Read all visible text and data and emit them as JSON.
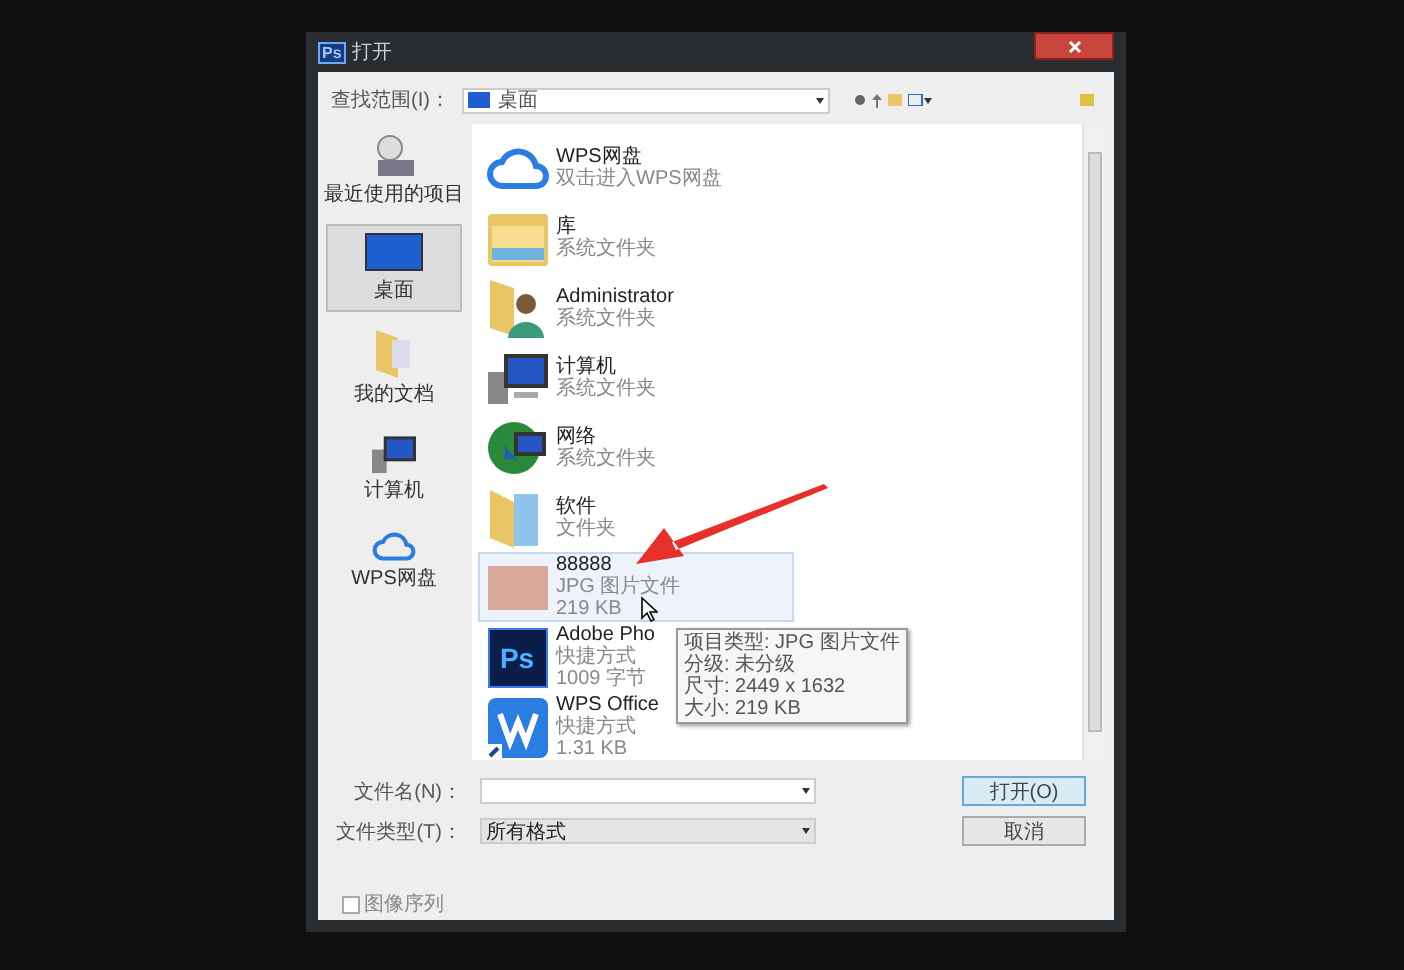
{
  "window": {
    "title": "打开",
    "app_badge": "Ps"
  },
  "look_in": {
    "label": "查找范围(I)：",
    "value": "桌面"
  },
  "sidebar": {
    "items": [
      {
        "label": "最近使用的项目",
        "kind": "recent",
        "selected": false
      },
      {
        "label": "桌面",
        "kind": "desktop",
        "selected": true
      },
      {
        "label": "我的文档",
        "kind": "documents",
        "selected": false
      },
      {
        "label": "计算机",
        "kind": "computer",
        "selected": false
      },
      {
        "label": "WPS网盘",
        "kind": "cloud",
        "selected": false
      }
    ]
  },
  "files": [
    {
      "name": "WPS网盘",
      "detail": [
        "双击进入WPS网盘"
      ],
      "kind": "cloud",
      "selected": false
    },
    {
      "name": "库",
      "detail": [
        "系统文件夹"
      ],
      "kind": "library",
      "selected": false
    },
    {
      "name": "Administrator",
      "detail": [
        "系统文件夹"
      ],
      "kind": "user",
      "selected": false
    },
    {
      "name": "计算机",
      "detail": [
        "系统文件夹"
      ],
      "kind": "computer",
      "selected": false
    },
    {
      "name": "网络",
      "detail": [
        "系统文件夹"
      ],
      "kind": "network",
      "selected": false
    },
    {
      "name": "软件",
      "detail": [
        "文件夹"
      ],
      "kind": "folder",
      "selected": false
    },
    {
      "name": "88888",
      "detail": [
        "JPG 图片文件",
        "219 KB"
      ],
      "kind": "image",
      "selected": true
    },
    {
      "name": "Adobe Pho",
      "detail": [
        "快捷方式",
        "1009 字节"
      ],
      "kind": "ps",
      "badge": "Ps",
      "selected": false
    },
    {
      "name": "WPS Office",
      "detail": [
        "快捷方式",
        "1.31 KB"
      ],
      "kind": "wps",
      "selected": false
    }
  ],
  "tooltip": [
    "项目类型: JPG 图片文件",
    "分级: 未分级",
    "尺寸: 2449 x 1632",
    "大小: 219 KB"
  ],
  "file_name": {
    "label": "文件名(N)："
  },
  "file_type": {
    "label": "文件类型(T)：",
    "value": "所有格式"
  },
  "buttons": [
    {
      "label": "打开(O)",
      "kind": "primary"
    },
    {
      "label": "取消",
      "kind": "normal"
    }
  ],
  "image_sequence": {
    "label": "图像序列",
    "checked": false
  }
}
